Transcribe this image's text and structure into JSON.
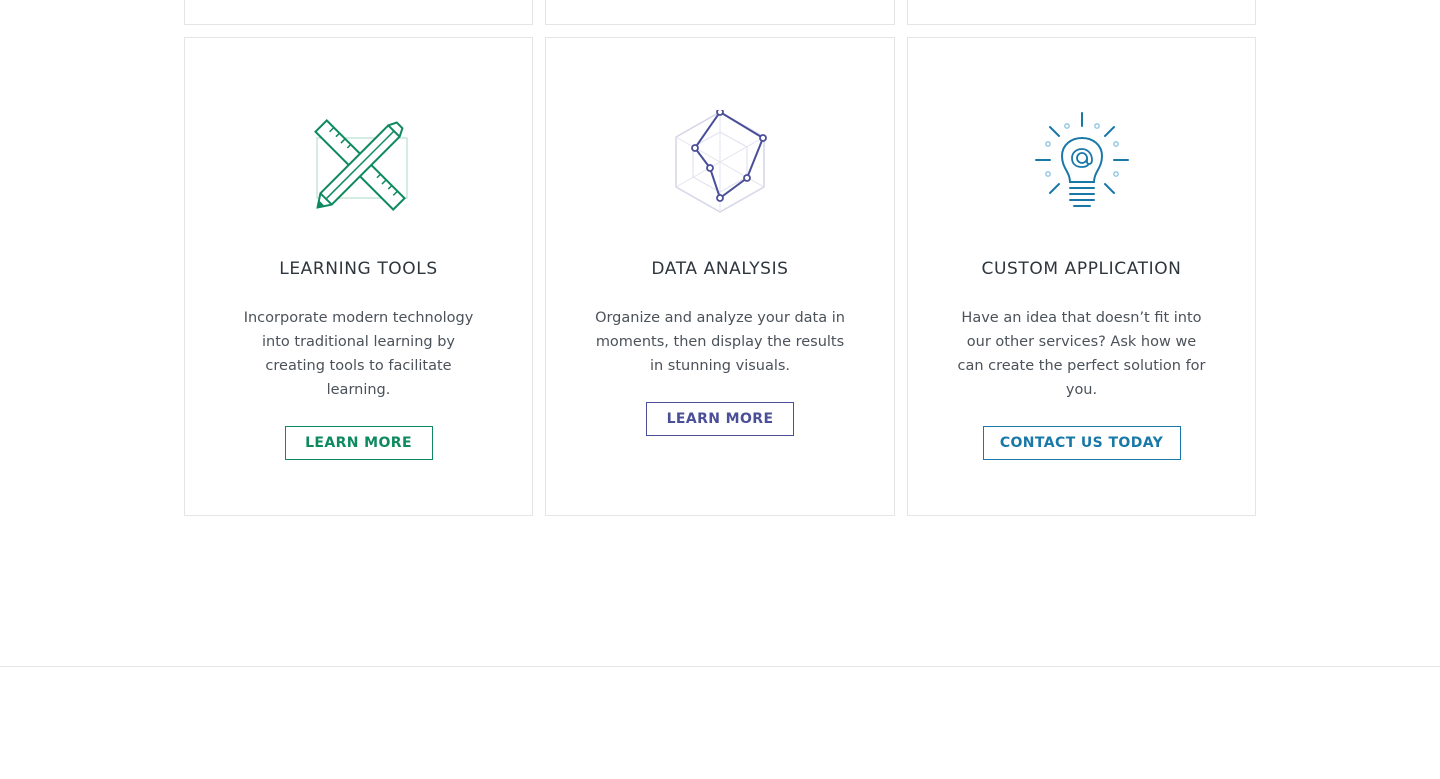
{
  "services": [
    {
      "title": "LEARNING TOOLS",
      "description": "Incorporate modern technology into traditional learning by creating tools to facilitate learning.",
      "button_label": "LEARN MORE",
      "icon": "pencil-ruler-icon",
      "accent": "#0f8a5f"
    },
    {
      "title": "DATA ANALYSIS",
      "description": "Organize and analyze your data in moments, then display the results in stunning visuals.",
      "button_label": "LEARN MORE",
      "icon": "radar-chart-icon",
      "accent": "#4a4f98"
    },
    {
      "title": "CUSTOM APPLICATION",
      "description": "Have an idea that doesn’t fit into our other services? Ask how we can create the perfect solution for you.",
      "button_label": "CONTACT US TODAY",
      "icon": "lightbulb-icon",
      "accent": "#1a78a8"
    }
  ]
}
